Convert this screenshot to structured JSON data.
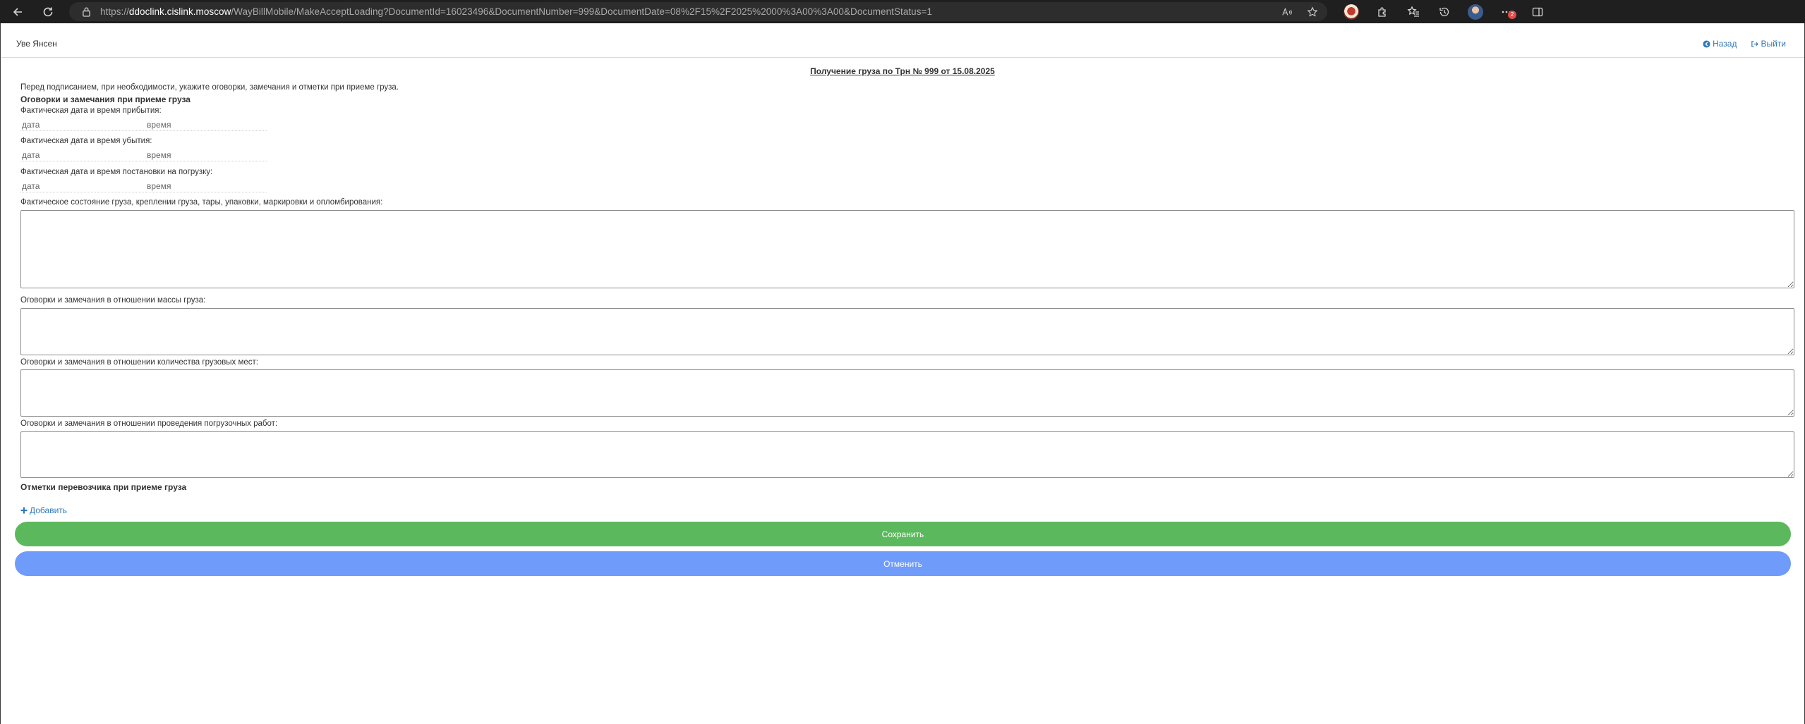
{
  "browser": {
    "url_scheme": "https://",
    "url_host": "ddoclink.cislink.moscow",
    "url_path": "/WayBillMobile/MakeAcceptLoading?DocumentId=16023496&DocumentNumber=999&DocumentDate=08%2F15%2F2025%2000%3A00%3A00&DocumentStatus=1",
    "notification_count": "2"
  },
  "header": {
    "user_name": "Уве Янсен",
    "back_label": "Назад",
    "logout_label": "Выйти"
  },
  "document": {
    "title": "Получение груза по Трн № 999 от 15.08.2025"
  },
  "form": {
    "intro": "Перед подписанием, при необходимости, укажите оговорки, замечания и отметки при приеме груза.",
    "section_remarks": "Оговорки и замечания при приеме груза",
    "arrival_label": "Фактическая дата и время прибытия:",
    "departure_label": "Фактическая дата и время убытия:",
    "loading_label": "Фактическая дата и время постановки на погрузку:",
    "date_placeholder": "дата",
    "time_placeholder": "время",
    "cargo_state_label": "Фактическое состояние груза, креплении груза, тары, упаковки, маркировки и опломбирования:",
    "mass_label": "Оговорки и замечания в отношении массы груза:",
    "quantity_label": "Оговорки и замечания в отношении количества грузовых мест:",
    "loading_works_label": "Оговорки и замечания в отношении проведения погрузочных работ:",
    "section_carrier": "Отметки перевозчика при приеме груза",
    "add_label": "Добавить",
    "save_label": "Сохранить",
    "cancel_label": "Отменить"
  },
  "colors": {
    "save": "#5cb85c",
    "cancel": "#6f9bfb",
    "link": "#337ab7"
  }
}
